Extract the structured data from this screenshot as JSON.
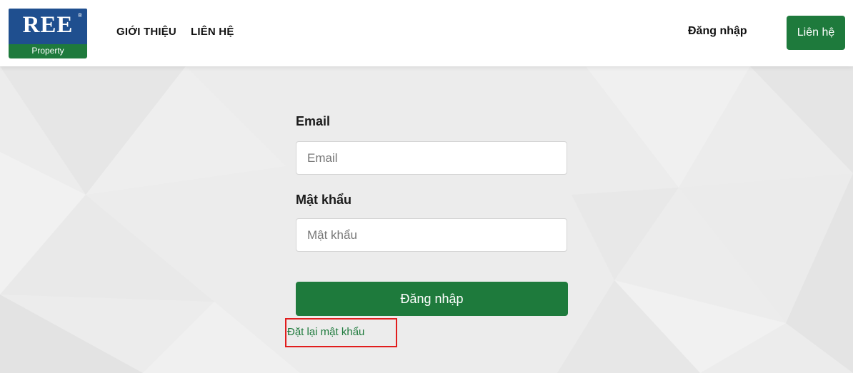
{
  "header": {
    "logo": {
      "brand": "REE",
      "registered": "®",
      "subtitle": "Property"
    },
    "nav": [
      {
        "label": "GIỚI THIỆU"
      },
      {
        "label": "LIÊN HỆ"
      }
    ],
    "login_link": "Đăng nhập",
    "contact_button": "Liên hệ"
  },
  "form": {
    "email": {
      "label": "Email",
      "placeholder": "Email",
      "value": ""
    },
    "password": {
      "label": "Mật khẩu",
      "placeholder": "Mật khẩu",
      "value": ""
    },
    "submit_label": "Đăng nhập",
    "reset_link": "Đặt lại mật khẩu"
  },
  "colors": {
    "brand_green": "#1e7a3c",
    "logo_blue": "#1f4f8f",
    "highlight_red": "#e11d1d",
    "background": "#ececec"
  }
}
